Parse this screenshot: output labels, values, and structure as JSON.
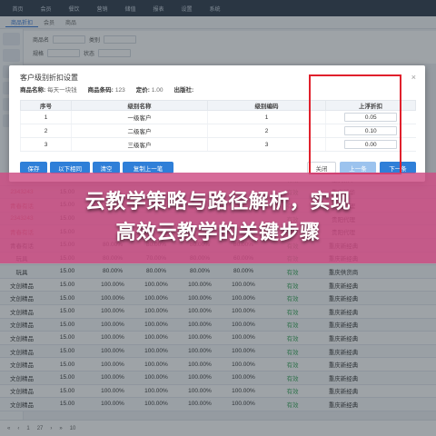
{
  "topnav": {
    "items": [
      "首页",
      "会员",
      "餐饮",
      "营销",
      "储值",
      "报表",
      "设置",
      "系统"
    ]
  },
  "tabs": [
    "商品折扣",
    "会员",
    "商品"
  ],
  "filters": {
    "label1": "商品名",
    "label2": "类别",
    "label3": "规格",
    "label4": "状态"
  },
  "modal": {
    "title": "客户级别折扣设置",
    "close": "×",
    "product": {
      "name_label": "商品名称:",
      "name_value": "每天一块钱",
      "code_label": "商品条码:",
      "code_value": "123",
      "price_label": "定价:",
      "price_value": "1.00",
      "publisher_label": "出版社:",
      "publisher_value": ""
    },
    "columns": [
      "序号",
      "级别名称",
      "级别编码",
      "上浮折扣"
    ],
    "rows": [
      {
        "no": "1",
        "level": "一级客户",
        "code": "1",
        "rate": "0.05"
      },
      {
        "no": "2",
        "level": "二级客户",
        "code": "2",
        "rate": "0.10"
      },
      {
        "no": "3",
        "level": "三级客户",
        "code": "3",
        "rate": "0.00"
      }
    ],
    "buttons": {
      "save": "保存",
      "apply_below": "以下相同",
      "clear": "清空",
      "copy_prev": "复制上一笔",
      "close": "关闭",
      "prev": "上一条",
      "next": "下一条"
    }
  },
  "banner": {
    "line1": "云教学策略与路径解析，实现",
    "line2": "高效云教学的关键步骤",
    "color": "#cd4b82"
  },
  "bgtable": {
    "rows": [
      [
        "2343243",
        "15.00",
        "",
        "",
        "",
        "",
        "有效",
        "重庆新华",
        ""
      ],
      [
        "2343243",
        "15.00",
        "",
        "",
        "",
        "",
        "有效",
        "重庆新华",
        ""
      ],
      [
        "青春有话",
        "15.00",
        "",
        "",
        "",
        "",
        "有效",
        "贵阳代理",
        ""
      ],
      [
        "2343243",
        "15.00",
        "",
        "",
        "",
        "",
        "有效",
        "贵阳代理",
        ""
      ],
      [
        "青春有话",
        "15.00",
        "",
        "",
        "",
        "",
        "有效",
        "贵阳代理",
        ""
      ],
      [
        "青春有话",
        "15.00",
        "80.00%",
        "80.00%",
        "80.00%",
        "80.00%",
        "有效",
        "重庆新经典",
        ""
      ],
      [
        "玩具",
        "15.00",
        "80.00%",
        "70.00%",
        "80.00%",
        "60.00%",
        "有效",
        "重庆新经典",
        ""
      ],
      [
        "玩具",
        "15.00",
        "80.00%",
        "80.00%",
        "80.00%",
        "80.00%",
        "有效",
        "重庆供货商",
        ""
      ],
      [
        "文创精品",
        "15.00",
        "100.00%",
        "100.00%",
        "100.00%",
        "100.00%",
        "有效",
        "重庆新经典",
        ""
      ],
      [
        "文创精品",
        "15.00",
        "100.00%",
        "100.00%",
        "100.00%",
        "100.00%",
        "有效",
        "重庆新经典",
        ""
      ],
      [
        "文创精品",
        "15.00",
        "100.00%",
        "100.00%",
        "100.00%",
        "100.00%",
        "有效",
        "重庆新经典",
        ""
      ],
      [
        "文创精品",
        "15.00",
        "100.00%",
        "100.00%",
        "100.00%",
        "100.00%",
        "有效",
        "重庆新经典",
        ""
      ],
      [
        "文创精品",
        "15.00",
        "100.00%",
        "100.00%",
        "100.00%",
        "100.00%",
        "有效",
        "重庆新经典",
        ""
      ],
      [
        "文创精品",
        "15.00",
        "100.00%",
        "100.00%",
        "100.00%",
        "100.00%",
        "有效",
        "重庆新经典",
        ""
      ],
      [
        "文创精品",
        "15.00",
        "100.00%",
        "100.00%",
        "100.00%",
        "100.00%",
        "有效",
        "重庆新经典",
        ""
      ],
      [
        "文创精品",
        "15.00",
        "100.00%",
        "100.00%",
        "100.00%",
        "100.00%",
        "有效",
        "重庆新经典",
        ""
      ],
      [
        "文创精品",
        "15.00",
        "100.00%",
        "100.00%",
        "100.00%",
        "100.00%",
        "有效",
        "重庆新经典",
        ""
      ],
      [
        "文创精品",
        "15.00",
        "100.00%",
        "100.00%",
        "100.00%",
        "100.00%",
        "有效",
        "重庆新经典",
        ""
      ]
    ]
  },
  "pager": {
    "page": "1",
    "total": "27",
    "size": "10"
  }
}
